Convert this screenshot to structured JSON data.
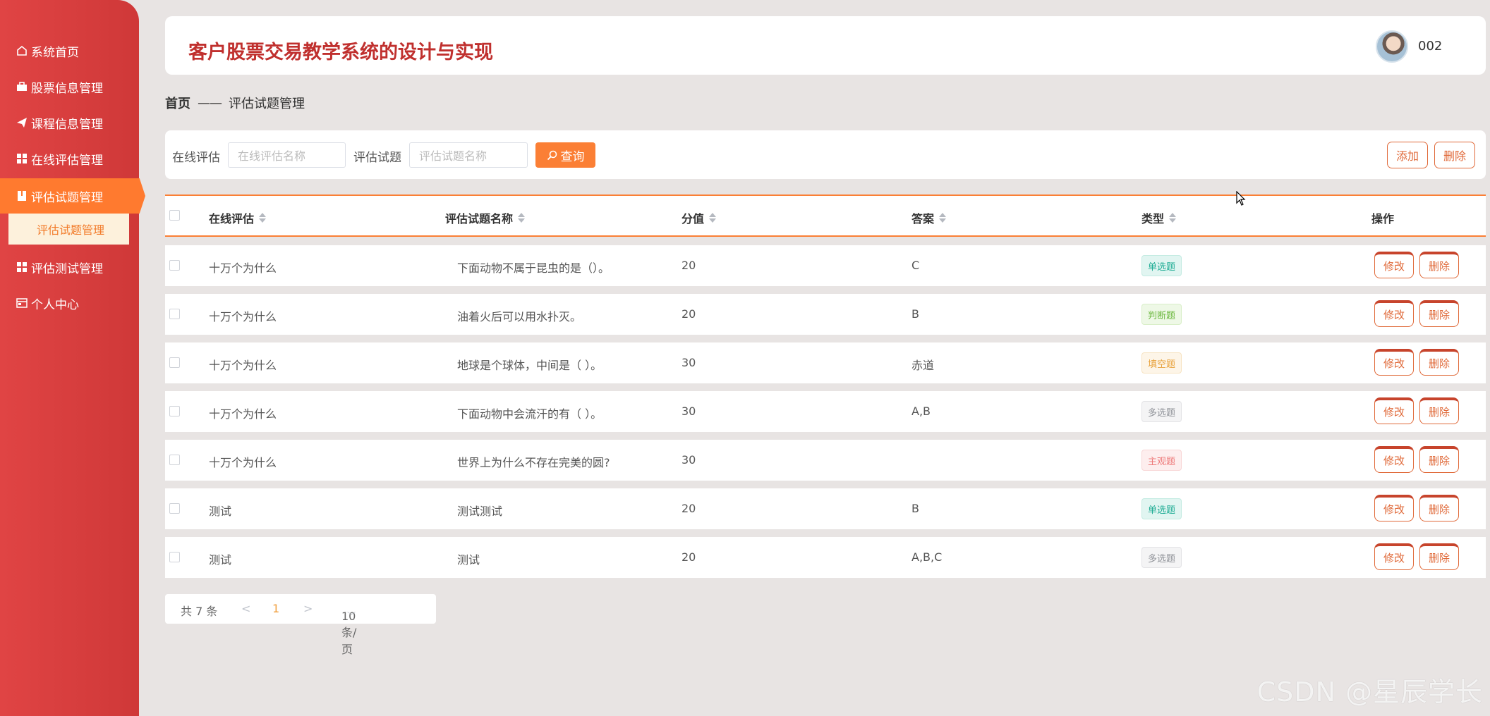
{
  "app": {
    "title": "客户股票交易教学系统的设计与实现",
    "username": "002"
  },
  "sidebar": {
    "items": [
      {
        "label": "系统首页",
        "icon": "home-icon"
      },
      {
        "label": "股票信息管理",
        "icon": "briefcase-icon"
      },
      {
        "label": "课程信息管理",
        "icon": "paper-plane-icon"
      },
      {
        "label": "在线评估管理",
        "icon": "grid-icon"
      },
      {
        "label": "评估试题管理",
        "icon": "book-icon"
      },
      {
        "label": "评估测试管理",
        "icon": "grid-icon"
      },
      {
        "label": "个人中心",
        "icon": "id-card-icon"
      }
    ],
    "active_index": 4,
    "submenu": {
      "label": "评估试题管理"
    }
  },
  "breadcrumb": {
    "home": "首页",
    "separator": "——",
    "current": "评估试题管理"
  },
  "search": {
    "field1_label": "在线评估",
    "field1_placeholder": "在线评估名称",
    "field2_label": "评估试题",
    "field2_placeholder": "评估试题名称",
    "query_label": "查询",
    "add_label": "添加",
    "delete_label": "删除"
  },
  "table": {
    "headers": [
      "在线评估",
      "评估试题名称",
      "分值",
      "答案",
      "类型",
      "操作"
    ],
    "edit_label": "修改",
    "delete_label": "删除",
    "rows": [
      {
        "assessment": "十万个为什么",
        "question": "下面动物不属于昆虫的是（）。",
        "score": "20",
        "answer": "C",
        "type": "单选题",
        "type_class": "single"
      },
      {
        "assessment": "十万个为什么",
        "question": "油着火后可以用水扑灭。",
        "score": "20",
        "answer": "B",
        "type": "判断题",
        "type_class": "judge"
      },
      {
        "assessment": "十万个为什么",
        "question": "地球是个球体，中间是（ ）。",
        "score": "30",
        "answer": "赤道",
        "type": "填空题",
        "type_class": "fill"
      },
      {
        "assessment": "十万个为什么",
        "question": "下面动物中会流汗的有（ ）。",
        "score": "30",
        "answer": "A,B",
        "type": "多选题",
        "type_class": "multi"
      },
      {
        "assessment": "十万个为什么",
        "question": "世界上为什么不存在完美的圆?",
        "score": "30",
        "answer": "",
        "type": "主观题",
        "type_class": "subj"
      },
      {
        "assessment": "测试",
        "question": "测试测试",
        "score": "20",
        "answer": "B",
        "type": "单选题",
        "type_class": "single"
      },
      {
        "assessment": "测试",
        "question": "测试",
        "score": "20",
        "answer": "A,B,C",
        "type": "多选题",
        "type_class": "multi"
      }
    ]
  },
  "pagination": {
    "total": "共 7 条",
    "prev": "<",
    "page": "1",
    "next": ">",
    "page_size": "10条/页"
  },
  "watermark": "CSDN @星辰学长",
  "colors": {
    "sidebar": "#d93c3c",
    "accent": "#fb7f35",
    "title": "#c0302e"
  }
}
